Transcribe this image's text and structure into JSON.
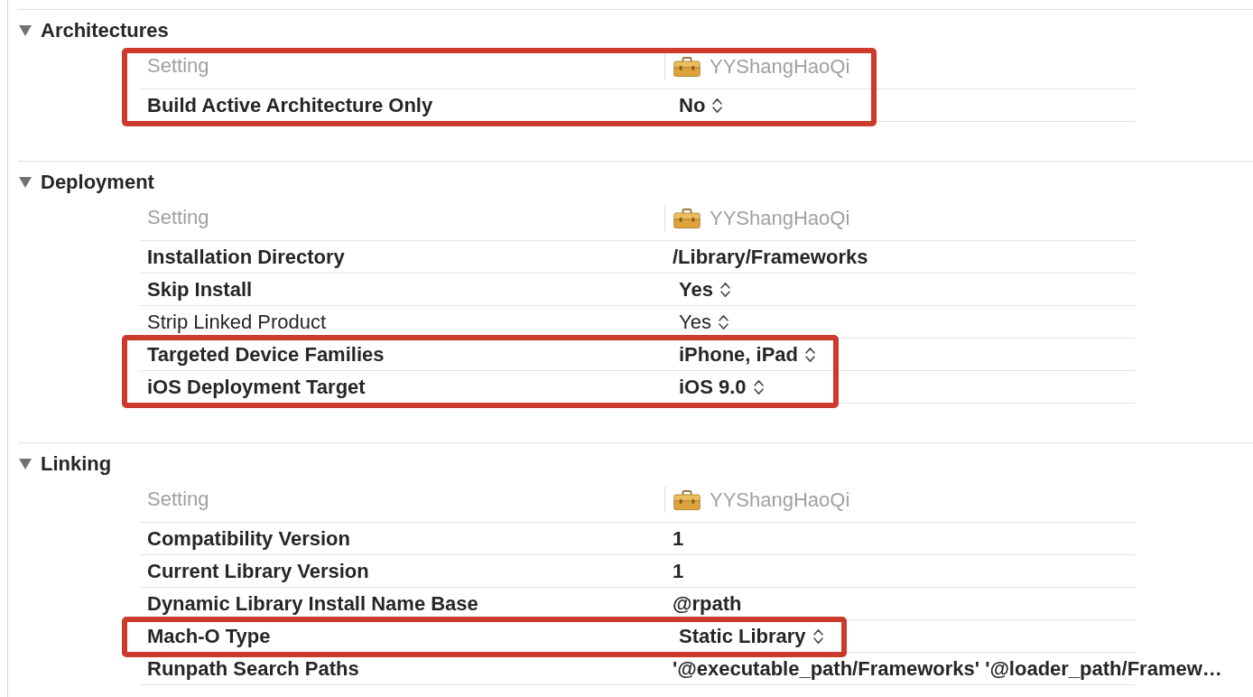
{
  "sections": [
    {
      "title": "Architectures",
      "expanded": true,
      "header": {
        "setting_label": "Setting",
        "target": "YYShangHaoQi",
        "highlighted": true
      },
      "rows": [
        {
          "label": "Build Active Architecture Only",
          "value": "No",
          "kind": "popup",
          "customized": true,
          "highlighted": true
        }
      ]
    },
    {
      "title": "Deployment",
      "expanded": true,
      "header": {
        "setting_label": "Setting",
        "target": "YYShangHaoQi",
        "highlighted": false
      },
      "rows": [
        {
          "label": "Installation Directory",
          "value": "/Library/Frameworks",
          "kind": "text",
          "customized": true,
          "highlighted": false
        },
        {
          "label": "Skip Install",
          "value": "Yes",
          "kind": "popup",
          "customized": true,
          "highlighted": false
        },
        {
          "label": "Strip Linked Product",
          "value": "Yes",
          "kind": "popup",
          "customized": false,
          "highlighted": false
        },
        {
          "label": "Targeted Device Families",
          "value": "iPhone, iPad",
          "kind": "popup",
          "customized": true,
          "highlighted": true
        },
        {
          "label": "iOS Deployment Target",
          "value": "iOS 9.0",
          "kind": "popup",
          "customized": true,
          "highlighted": true
        }
      ]
    },
    {
      "title": "Linking",
      "expanded": true,
      "header": {
        "setting_label": "Setting",
        "target": "YYShangHaoQi",
        "highlighted": false
      },
      "rows": [
        {
          "label": "Compatibility Version",
          "value": "1",
          "kind": "text",
          "customized": true,
          "highlighted": false
        },
        {
          "label": "Current Library Version",
          "value": "1",
          "kind": "text",
          "customized": true,
          "highlighted": false
        },
        {
          "label": "Dynamic Library Install Name Base",
          "value": "@rpath",
          "kind": "text",
          "customized": true,
          "highlighted": false
        },
        {
          "label": "Mach-O Type",
          "value": "Static Library",
          "kind": "popup",
          "customized": true,
          "highlighted": true
        },
        {
          "label": "Runpath Search Paths",
          "value": "'@executable_path/Frameworks' '@loader_path/Framew…",
          "kind": "text",
          "customized": true,
          "highlighted": false
        }
      ]
    }
  ]
}
